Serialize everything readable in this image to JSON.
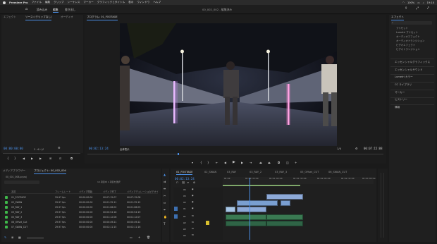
{
  "menubar": {
    "app": "Premiere Pro",
    "items": [
      "ファイル",
      "編集",
      "クリップ",
      "シーケンス",
      "マーカー",
      "グラフィックとタイトル",
      "表示",
      "ウィンドウ",
      "ヘルプ"
    ],
    "battery": "100%",
    "time": "19:10"
  },
  "header": {
    "tabs": [
      "読み込み",
      "編集",
      "書き出し"
    ],
    "active_tab": "編集",
    "project_title": "00_002_002 - 編集済み"
  },
  "source_panel": {
    "tabs": [
      "ソース: (クリップなし)",
      "オーディオ"
    ],
    "left_tab": "エフェクト",
    "timecode": "00:00:00:00",
    "page": "1 ページ"
  },
  "program_panel": {
    "title": "プログラム: 01_FOOTAGE",
    "timecode": "00:02:13:24",
    "fit": "全体表示",
    "quality": "1/4",
    "duration": "00:07:15:08"
  },
  "effects_panel": {
    "title": "エフェクト",
    "presets": [
      "プリセット",
      "Lumetri プリセット",
      "オーディオエフェクト",
      "オーディオトランジション",
      "ビデオエフェクト",
      "ビデオトランジション"
    ],
    "sections": [
      "エッセンシャルグラフィックス",
      "エッセンシャルサウンド",
      "Lumetri カラー",
      "CC ライブラリ",
      "マーカー",
      "ヒストリー",
      "情報"
    ]
  },
  "project_panel": {
    "tabs": [
      "メディアブラウザー",
      "プロジェクト: 00_002_004"
    ],
    "file": "00_001_008.prproj",
    "count": "10 項目中 1 項目を選択",
    "columns": [
      "名前",
      "フレームレート",
      "メディア開始",
      "メディア終了",
      "メディアデュレーション",
      "ビデオイ"
    ],
    "rows": [
      {
        "name": "01_FOOTAGE",
        "fps": "29.97 fps",
        "start": "00:00:00:00",
        "end": "00:07:15:07",
        "dur": "00:07:15:08",
        "color": "#3fb84a"
      },
      {
        "name": "02_SWAN",
        "fps": "29.97 fps",
        "start": "00:00:00:00",
        "end": "00:01:35:11",
        "dur": "00:01:35:12",
        "color": "#3fb84a"
      },
      {
        "name": "03_RAY_1",
        "fps": "29.97 fps",
        "start": "00:00:00:00",
        "end": "00:01:08:02",
        "dur": "00:01:08:03",
        "color": "#3fb84a"
      },
      {
        "name": "03_RAY_2",
        "fps": "29.97 fps",
        "start": "00:00:00:00",
        "end": "00:00:54:18",
        "dur": "00:00:54:19",
        "color": "#3fb84a"
      },
      {
        "name": "05_RAY_3",
        "fps": "29.97 fps",
        "start": "00:00:00:00",
        "end": "00:01:12:06",
        "dur": "00:01:12:07",
        "color": "#3fb84a"
      },
      {
        "name": "06_Offset_Cut",
        "fps": "29.97 fps",
        "start": "00:00:00:00",
        "end": "00:00:49:21",
        "dur": "00:00:49:22",
        "color": "#3fb84a"
      },
      {
        "name": "07_SWAN_CUT",
        "fps": "29.97 fps",
        "start": "00:00:00:00",
        "end": "00:02:11:15",
        "dur": "00:02:11:16",
        "color": "#3fb84a"
      }
    ]
  },
  "timeline": {
    "tabs": [
      "01_FOOTAGE",
      "02_SWAN",
      "03_RAY",
      "03_RAY_2",
      "03_RAY_3",
      "05_Offset_CUT",
      "06_SWAN_CUT"
    ],
    "timecode": "00:02:13:24",
    "ruler": [
      "00:00",
      "00:00:30:00",
      "00:01:00:00",
      "00:01:30:00",
      "00:02:00:00",
      "00:02:30:00",
      "00:03:00:00"
    ],
    "tracks": [
      "V4",
      "V3",
      "V2",
      "V1",
      "A1",
      "A2",
      "A3",
      "A4"
    ]
  },
  "colors": {
    "accent": "#4a8fe7",
    "clip_blue": "#7a9fd1",
    "clip_light": "#a7c6e6",
    "audio_green": "#3a7a52",
    "project_label": "#3fb84a"
  }
}
